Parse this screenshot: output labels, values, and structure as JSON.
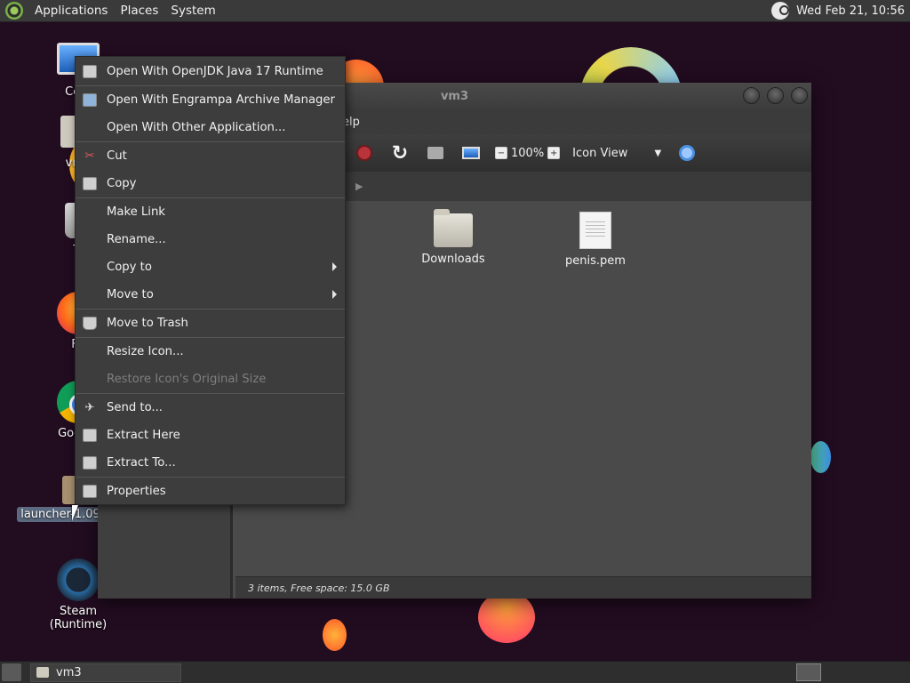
{
  "top_panel": {
    "menus": [
      "Applications",
      "Places",
      "System"
    ],
    "clock": "Wed Feb 21, 10:56"
  },
  "desktop_icons": [
    {
      "label": "Com",
      "icon": "computer-icon"
    },
    {
      "label": "vm3",
      "icon": "home-folder-icon"
    },
    {
      "label": "Tr",
      "icon": "trash-icon"
    },
    {
      "label": "Fir",
      "icon": "firefox-icon"
    },
    {
      "label": "Google",
      "icon": "chrome-icon"
    },
    {
      "label": "launcher-1.09",
      "icon": "archive-icon"
    },
    {
      "label": "Steam (Runtime)",
      "icon": "steam-icon"
    }
  ],
  "window": {
    "title": "vm3",
    "menubar_visible": "elp",
    "zoom": "100%",
    "view_mode": "Icon View",
    "files": [
      {
        "name": "Downloads",
        "type": "folder"
      },
      {
        "name": "penis.pem",
        "type": "document"
      }
    ],
    "status": "3 items, Free space: 15.0 GB"
  },
  "context_menu": {
    "groups": [
      [
        {
          "label": "Open With OpenJDK Java 17 Runtime",
          "icon": "java-icon"
        },
        {
          "label": "Open With Engrampa Archive Manager",
          "icon": "archive-manager-icon"
        },
        {
          "label": "Open With Other Application...",
          "icon": ""
        }
      ],
      [
        {
          "label": "Cut",
          "icon": "scissors-icon"
        },
        {
          "label": "Copy",
          "icon": "copy-icon"
        }
      ],
      [
        {
          "label": "Make Link",
          "icon": ""
        },
        {
          "label": "Rename...",
          "icon": ""
        },
        {
          "label": "Copy to",
          "icon": "",
          "submenu": true
        },
        {
          "label": "Move to",
          "icon": "",
          "submenu": true
        }
      ],
      [
        {
          "label": "Move to Trash",
          "icon": "trash-icon"
        }
      ],
      [
        {
          "label": "Resize Icon...",
          "icon": ""
        },
        {
          "label": "Restore Icon's Original Size",
          "icon": "",
          "disabled": true
        }
      ],
      [
        {
          "label": "Send to...",
          "icon": "send-icon"
        },
        {
          "label": "Extract Here",
          "icon": "extract-icon"
        },
        {
          "label": "Extract To...",
          "icon": "extract-icon"
        }
      ],
      [
        {
          "label": "Properties",
          "icon": "properties-icon"
        }
      ]
    ]
  },
  "bottom_panel": {
    "task": "vm3"
  }
}
